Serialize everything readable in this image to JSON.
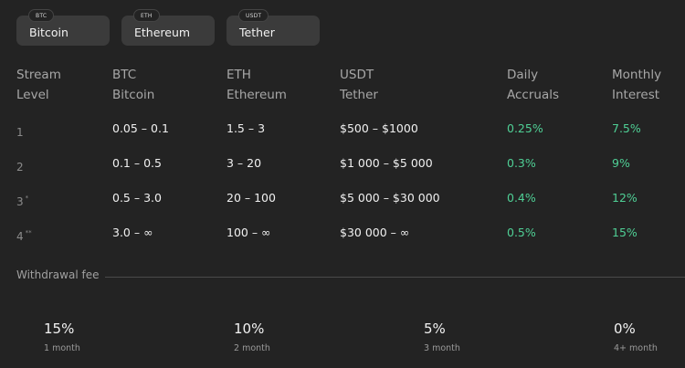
{
  "coins": [
    {
      "tag": "BTC",
      "name": "Bitcoin"
    },
    {
      "tag": "ETH",
      "name": "Ethereum"
    },
    {
      "tag": "USDT",
      "name": "Tether"
    }
  ],
  "table": {
    "headers": [
      {
        "line1": "Stream",
        "line2": "Level"
      },
      {
        "line1": "BTC",
        "line2": "Bitcoin"
      },
      {
        "line1": "ETH",
        "line2": "Ethereum"
      },
      {
        "line1": "USDT",
        "line2": "Tether"
      },
      {
        "line1": "Daily",
        "line2": "Accruals"
      },
      {
        "line1": "Monthly",
        "line2": "Interest"
      }
    ],
    "rows": [
      {
        "level": "1",
        "mark": "",
        "btc": "0.05 – 0.1",
        "eth": "1.5 – 3",
        "usdt": "$500 – $1000",
        "daily": "0.25%",
        "monthly": "7.5%"
      },
      {
        "level": "2",
        "mark": "",
        "btc": "0.1 – 0.5",
        "eth": "3 – 20",
        "usdt": "$1 000 – $5 000",
        "daily": "0.3%",
        "monthly": "9%"
      },
      {
        "level": "3",
        "mark": "*",
        "btc": "0.5 – 3.0",
        "eth": "20 – 100",
        "usdt": "$5 000 – $30 000",
        "daily": "0.4%",
        "monthly": "12%"
      },
      {
        "level": "4",
        "mark": "**",
        "btc": "3.0 – ∞",
        "eth": "100 – ∞",
        "usdt": "$30 000 – ∞",
        "daily": "0.5%",
        "monthly": "15%"
      }
    ]
  },
  "withdrawal": {
    "label": "Withdrawal fee",
    "fees": [
      {
        "percent": "15%",
        "period": "1 month"
      },
      {
        "percent": "10%",
        "period": "2 month"
      },
      {
        "percent": "5%",
        "period": "3 month"
      },
      {
        "percent": "0%",
        "period": "4+ month"
      }
    ]
  },
  "colors": {
    "background": "#232323",
    "button": "#3b3b3b",
    "accent_green": "#4fcf95"
  }
}
